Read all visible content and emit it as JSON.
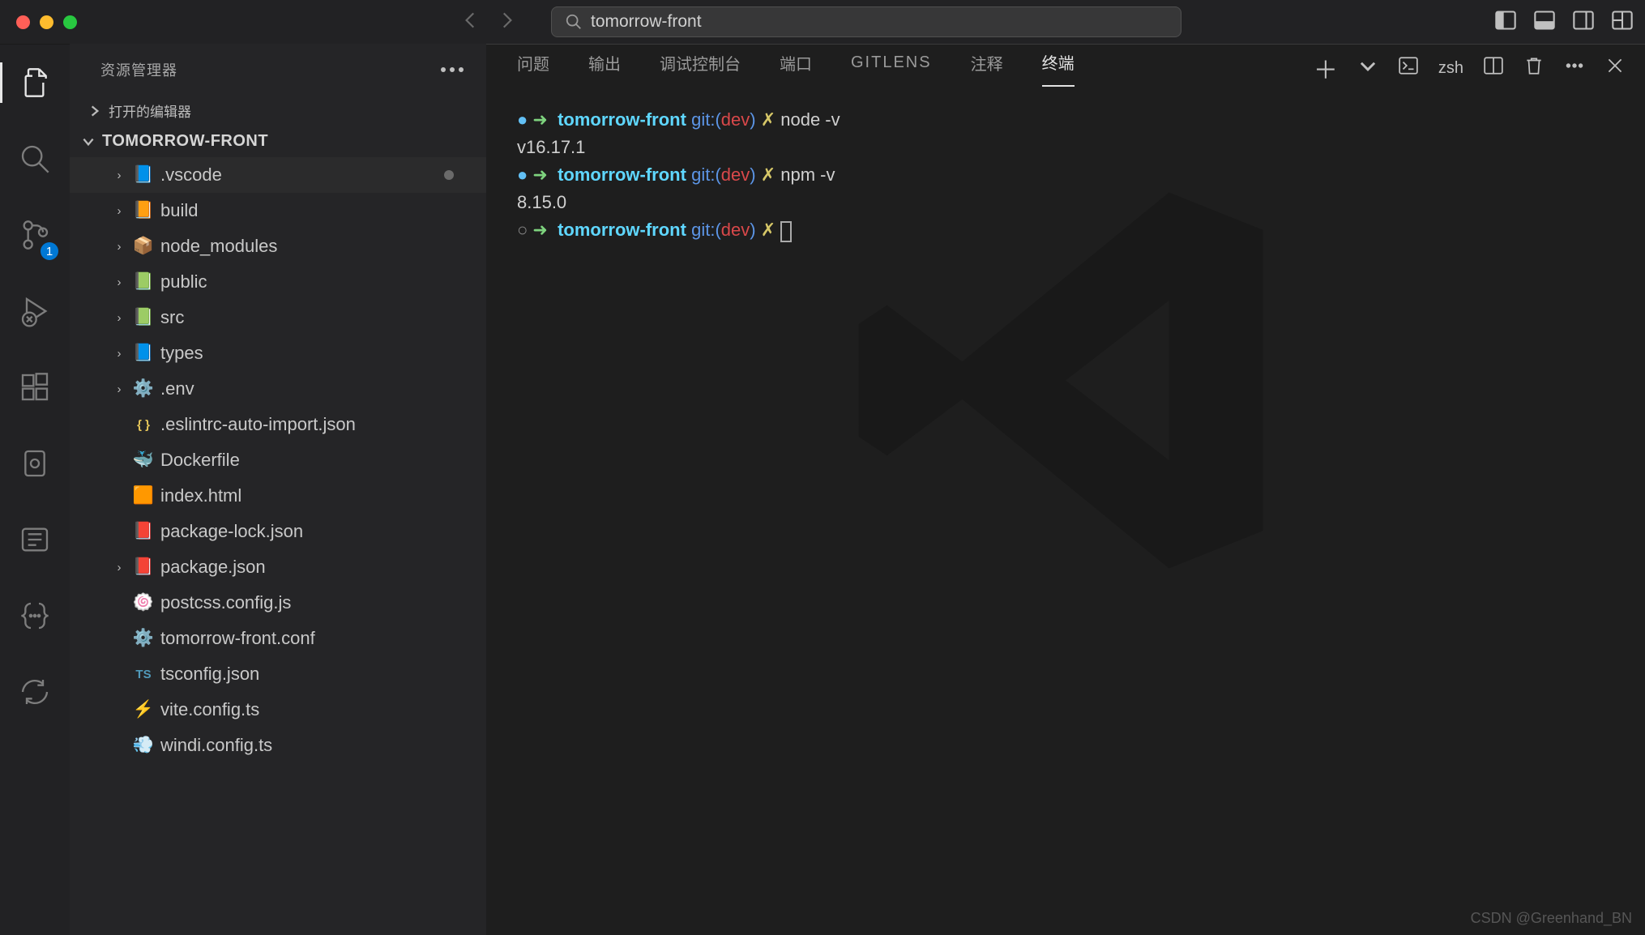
{
  "title": {
    "search": "tomorrow-front"
  },
  "sidebar": {
    "explorerLabel": "资源管理器",
    "openEditors": "打开的编辑器",
    "root": "TOMORROW-FRONT",
    "tree": [
      {
        "name": ".vscode",
        "icon": "📘",
        "folder": true,
        "selected": true,
        "modified": true
      },
      {
        "name": "build",
        "icon": "📙",
        "folder": true
      },
      {
        "name": "node_modules",
        "icon": "📦",
        "folder": true
      },
      {
        "name": "public",
        "icon": "📗",
        "folder": true
      },
      {
        "name": "src",
        "icon": "📗",
        "folder": true
      },
      {
        "name": "types",
        "icon": "📘",
        "folder": true
      },
      {
        "name": ".env",
        "icon": "⚙️",
        "folder": true
      },
      {
        "name": ".eslintrc-auto-import.json",
        "icon": "{ }",
        "iconColor": "#e8c85a"
      },
      {
        "name": "Dockerfile",
        "icon": "🐳"
      },
      {
        "name": "index.html",
        "icon": "🟧"
      },
      {
        "name": "package-lock.json",
        "icon": "📕"
      },
      {
        "name": "package.json",
        "icon": "📕",
        "folder": true
      },
      {
        "name": "postcss.config.js",
        "icon": "🍥"
      },
      {
        "name": "tomorrow-front.conf",
        "icon": "⚙️"
      },
      {
        "name": "tsconfig.json",
        "icon": "TS",
        "iconColor": "#519aba"
      },
      {
        "name": "vite.config.ts",
        "icon": "⚡"
      },
      {
        "name": "windi.config.ts",
        "icon": "💨"
      }
    ]
  },
  "activity": {
    "scmBadge": "1"
  },
  "panel": {
    "tabs": [
      "问题",
      "输出",
      "调试控制台",
      "端口",
      "GITLENS",
      "注释",
      "终端"
    ],
    "active": 6,
    "shell": "zsh"
  },
  "terminal": {
    "lines": [
      {
        "dot": "●",
        "path": "tomorrow-front",
        "cmd": "node -v"
      },
      {
        "output": "v16.17.1"
      },
      {
        "dot": "●",
        "path": "tomorrow-front",
        "cmd": "npm -v"
      },
      {
        "output": "8.15.0"
      },
      {
        "dot": "○",
        "path": "tomorrow-front",
        "cursor": true
      }
    ],
    "git": {
      "label": "git:",
      "branch": "dev"
    }
  },
  "watermark": "CSDN @Greenhand_BN"
}
